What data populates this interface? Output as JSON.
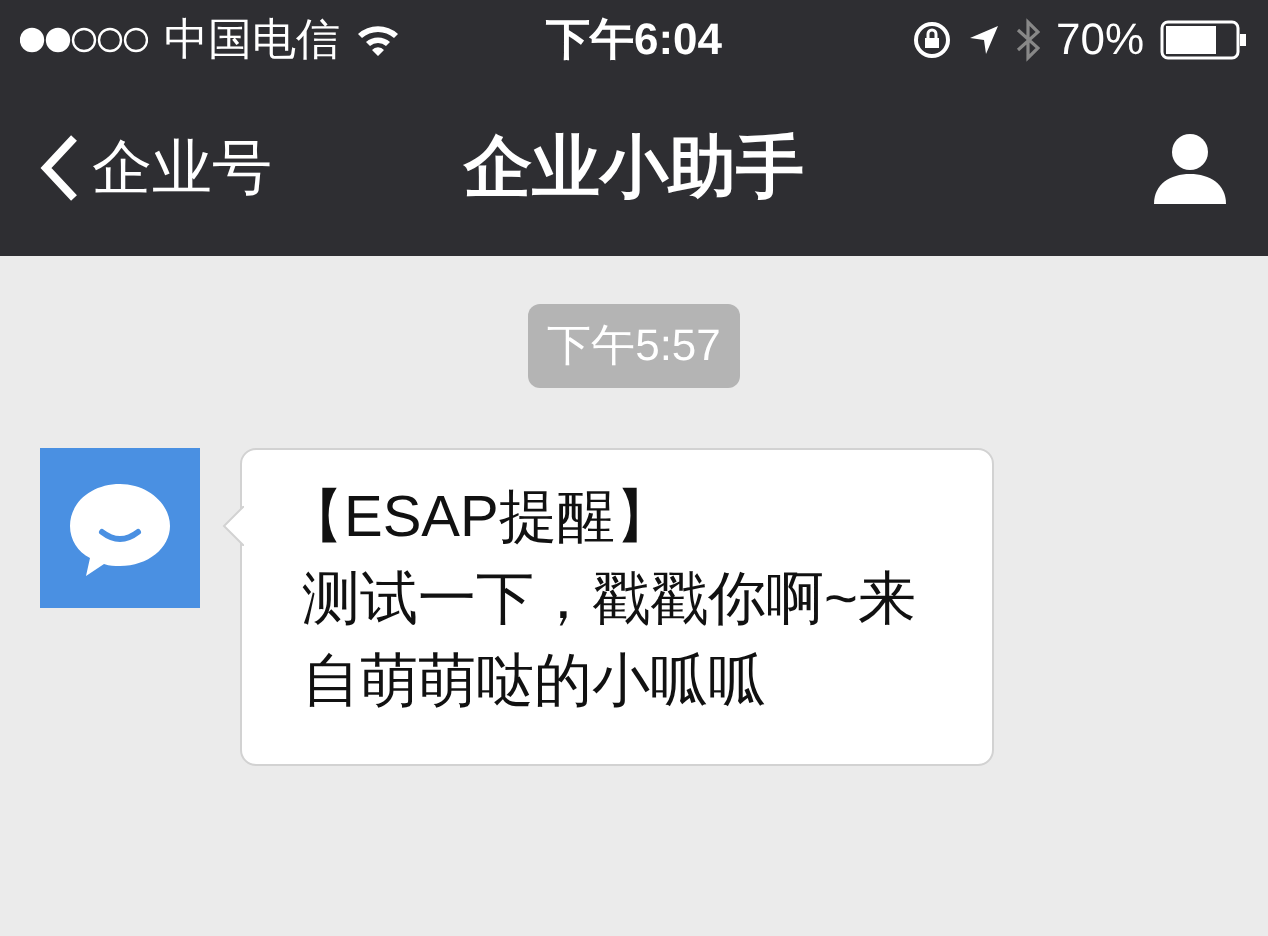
{
  "status_bar": {
    "carrier": "中国电信",
    "time": "下午6:04",
    "battery": "70%"
  },
  "nav_bar": {
    "back": "企业号",
    "title": "企业小助手"
  },
  "messages": [
    {
      "kind": "time",
      "text": "下午5:57"
    },
    {
      "kind": "incoming",
      "lines": [
        "【ESAP提醒】",
        "测试一下，戳戳你啊~来自萌萌哒的小呱呱"
      ]
    }
  ]
}
